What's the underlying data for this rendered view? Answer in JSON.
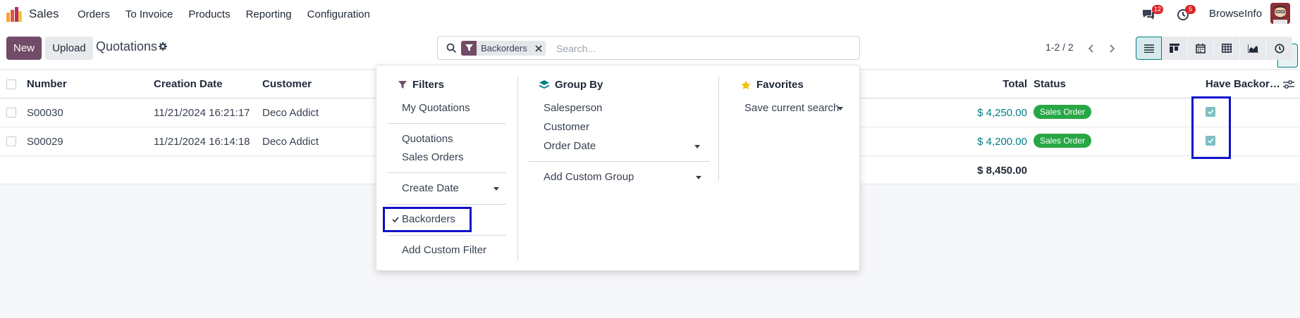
{
  "app": {
    "name": "Sales"
  },
  "menu": [
    "Orders",
    "To Invoice",
    "Products",
    "Reporting",
    "Configuration"
  ],
  "systray": {
    "messages_count": "12",
    "activities_count": "5",
    "company": "BrowseInfo"
  },
  "control": {
    "new_label": "New",
    "upload_label": "Upload",
    "breadcrumb": "Quotations"
  },
  "search": {
    "facet": "Backorders",
    "placeholder": "Search..."
  },
  "pager": {
    "value": "1-2 / 2"
  },
  "table": {
    "headers": {
      "number": "Number",
      "creation_date": "Creation Date",
      "customer": "Customer",
      "total": "Total",
      "status": "Status",
      "backorder": "Have Backor…"
    },
    "rows": [
      {
        "number": "S00030",
        "creation_date": "11/21/2024 16:21:17",
        "customer": "Deco Addict",
        "total": "$ 4,250.00",
        "status": "Sales Order",
        "backorder_checked": true
      },
      {
        "number": "S00029",
        "creation_date": "11/21/2024 16:14:18",
        "customer": "Deco Addict",
        "total": "$ 4,200.00",
        "status": "Sales Order",
        "backorder_checked": true
      }
    ],
    "sum_total": "$ 8,450.00"
  },
  "dropdown": {
    "filters": {
      "title": "Filters",
      "items": [
        "My Quotations",
        "Quotations",
        "Sales Orders",
        "Create Date",
        "Backorders",
        "Add Custom Filter"
      ]
    },
    "groupby": {
      "title": "Group By",
      "items": [
        "Salesperson",
        "Customer",
        "Order Date",
        "Add Custom Group"
      ]
    },
    "favorites": {
      "title": "Favorites",
      "items": [
        "Save current search"
      ]
    }
  },
  "colors": {
    "brand": "#714b67",
    "accent": "#017e84",
    "success": "#28a745",
    "highlight": "#1010cc",
    "badge": "#dc2626"
  }
}
